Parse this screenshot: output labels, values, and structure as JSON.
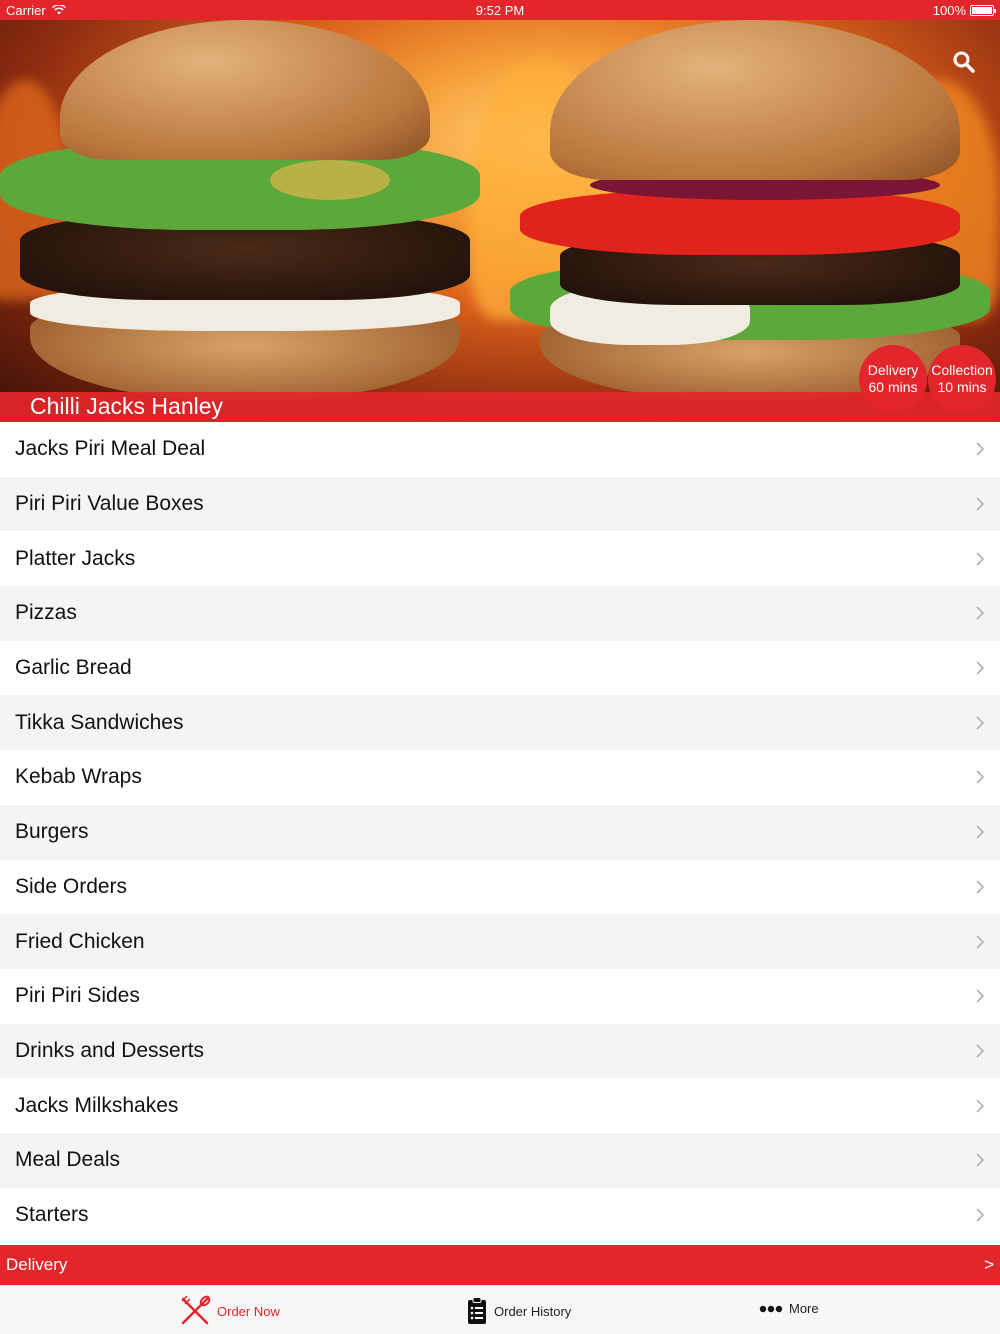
{
  "status_bar": {
    "carrier": "Carrier",
    "time": "9:52 PM",
    "battery": "100%",
    "battery_level": 1.0
  },
  "hero": {
    "restaurant_name": "Chilli Jacks Hanley",
    "search_icon": "search-icon",
    "delivery_badge": {
      "label": "Delivery",
      "time": "60 mins"
    },
    "collection_badge": {
      "label": "Collection",
      "time": "10 mins"
    }
  },
  "menu": {
    "items": [
      "Jacks Piri Meal Deal",
      "Piri Piri Value Boxes",
      "Platter Jacks",
      "Pizzas",
      "Garlic Bread",
      "Tikka Sandwiches",
      "Kebab Wraps",
      "Burgers",
      "Side Orders",
      "Fried Chicken",
      "Piri Piri Sides",
      "Drinks and Desserts",
      "Jacks Milkshakes",
      "Meal Deals",
      "Starters"
    ]
  },
  "delivery_bar": {
    "label": "Delivery",
    "arrow": ">"
  },
  "tab_bar": {
    "order_now": "Order Now",
    "order_history": "Order History",
    "more": "More"
  },
  "colors": {
    "accent": "#e3262b"
  }
}
